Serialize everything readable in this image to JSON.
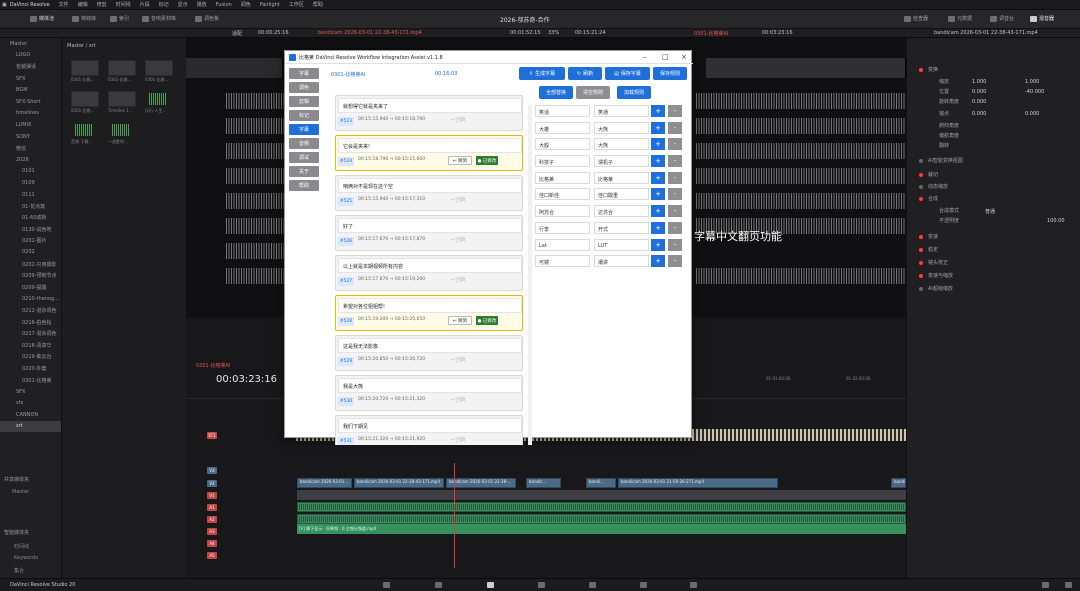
{
  "app": {
    "name": "DaVinci Resolve",
    "menus": [
      "文件",
      "编辑",
      "修剪",
      "时间线",
      "片段",
      "标记",
      "显示",
      "播放",
      "Fusion",
      "调色",
      "Fairlight",
      "工作区",
      "帮助"
    ]
  },
  "toolbar": {
    "items": [
      "媒体池",
      "特效库",
      "索引",
      "音响素材库",
      "调色板"
    ],
    "right_items": [
      "检查器",
      "元数据",
      "调音台",
      "混音器"
    ],
    "project_title": "2026-邬苏奇-合作"
  },
  "timebar": {
    "zoom": "适配",
    "tc1": "00:00:25:16",
    "clip_name": "bandicam 2026-03-01 22-38-43-171.mp4",
    "tc2": "00:01:52:15",
    "percent": "33%",
    "tc3": "00:15:21:24",
    "tl_name": "0301-比格莱AI",
    "tc4": "00:03:23:16",
    "insp_clip": "bandicam 2026-03-01 22-38-43-171.mp4"
  },
  "bins": [
    "Master",
    "LOGO",
    "包装弹话",
    "SFX",
    "BGM",
    "SFX-Short",
    "timelines",
    "LUMIX",
    "SONY",
    "微信",
    "2026",
    "0101",
    "0109",
    "0111",
    "01-花点篇",
    "01-60成新",
    "0130-说色地",
    "0201-图片",
    "0202",
    "0202-只用摄影",
    "0209-预制节点",
    "0209-提醒",
    "0210-thenog...",
    "0212-混杂调色",
    "0216-拍色帖",
    "0217-混杂调色",
    "0218-清高华",
    "0219-紫云台",
    "0220-外套",
    "0301-比格莱",
    "SFX",
    "sfx",
    "CANNON",
    "srt"
  ],
  "bins_bottom": {
    "shared": "共享媒体夹",
    "master": "Master",
    "smart": "智能媒体夹",
    "items": [
      "时间线",
      "Keywords",
      "集合"
    ]
  },
  "media": {
    "header": "Master / srt",
    "thumbs": [
      "0301-比格...",
      "0301-比格...",
      "0301-比格...",
      "0301-比格...",
      "Timeline 1...",
      "乐行-人生..",
      "音频-下载...",
      "一战胜利..."
    ]
  },
  "inspector": {
    "rows": [
      "变换",
      "缩放",
      "位置",
      "旋转角度",
      "锚点",
      "俯仰角度",
      "偏航角度",
      "翻转",
      "AI智能变换抠图",
      "裁切",
      "动态缩放",
      "合成",
      "合成模式",
      "不透明度",
      "变速",
      "稳定",
      "镜头校正",
      "变速与缩放",
      "AI超级缩放"
    ],
    "values": {
      "zoom_x": "1.000",
      "zoom_y": "1.000",
      "pos_x": "0.000",
      "pos_y": "-40.000",
      "rot": "0.000",
      "anchor_x": "0.000",
      "anchor_y": "0.000",
      "comp_mode": "普通",
      "opacity": "100.00"
    }
  },
  "timeline": {
    "tc": "00:03:23:16",
    "tab": "0301-比格莱AI",
    "tracks": [
      "ST1",
      "V3",
      "V2",
      "V1",
      "A1",
      "A2",
      "A3",
      "A4",
      "A5"
    ],
    "video_clips": [
      "bandicam 2026-03-01...",
      "bandicam 2026-03-01 22-38-43-171.mp4",
      "bandicam 2026-03-01 22-38-...",
      "bandic...",
      "bandi...",
      "bandicam 2026-03-01 21-50-26-271.mp4",
      "bandi...",
      "bandicam 2026-03-01 21-50-26-271.mp4"
    ],
    "sub_clip": "[V] 脚下显示 - 风筝频 : 0.主频分频道.mp4",
    "ruler": [
      "01:01:00:00",
      "01:02:00:00",
      "01:03:00:00",
      "01:04:00:00",
      "01:05:00:00"
    ]
  },
  "bottombar": {
    "product": "DaVinci Resolve Studio 20"
  },
  "modal": {
    "title": "比格莱 DaVinci Resolve Workflow Integration Assist v1.1.8",
    "side": [
      "字幕",
      "调色",
      "剪辑",
      "标记",
      "字幕",
      "音频",
      "调试",
      "关于",
      "帮助"
    ],
    "head_left": "0301-比格莱AI",
    "head_right": "00:16:03",
    "btns": {
      "gen": "生成字幕",
      "refresh": "刷新",
      "save": "保存字幕",
      "save_rules": "保存规则",
      "replace_all": "全部替换",
      "clear": "清空规则",
      "load": "加载规则"
    },
    "subs": [
      {
        "text": "就想得它就是夹来了",
        "idx": "#523",
        "tc": "00:15:15,940 → 00:15:18,790",
        "ph": "↩ 回跳"
      },
      {
        "text": "它会是夹来!",
        "idx": "#524",
        "tc": "00:15:18,790 → 00:15:15,600",
        "jump": "↩ 跳到",
        "done": "● 已修改"
      },
      {
        "text": "咱俩对不是现在这个空",
        "idx": "#525",
        "tc": "00:15:15,940 → 00:15:17,310",
        "ph": "↩ 回跳"
      },
      {
        "text": "好了",
        "idx": "#526",
        "tc": "00:15:17,670 → 00:15:17,870",
        "ph": "↩ 回跳"
      },
      {
        "text": "以上就是本期视频所有内容",
        "idx": "#527",
        "tc": "00:15:17,870 → 00:15:19,200",
        "ph": "↩ 回跳"
      },
      {
        "text": "希望对各位姐姐帮!",
        "idx": "#528",
        "tc": "00:15:19,200 → 00:15:20,650",
        "jump": "↩ 跳到",
        "done": "● 已修改"
      },
      {
        "text": "这是我无法影像",
        "idx": "#529",
        "tc": "00:15:20,850 → 00:15:20,720",
        "ph": "↩ 回跳"
      },
      {
        "text": "我是大熊",
        "idx": "#530",
        "tc": "00:15:20,720 → 00:15:21,320",
        "ph": "↩ 回跳"
      },
      {
        "text": "我们下期见",
        "idx": "#531",
        "tc": "00:15:21,320 → 00:15:21,920",
        "ph": "↩ 回跳"
      }
    ],
    "rules": [
      [
        "笑话",
        "笑通"
      ],
      [
        "大雄",
        "大熊"
      ],
      [
        "大殴",
        "大熊"
      ],
      [
        "科技子",
        "谓机子"
      ],
      [
        "比格莱",
        "比格莱"
      ],
      [
        "佳口新佳",
        "佳口酸重"
      ],
      [
        "阿苏合",
        "达苏合"
      ],
      [
        "行李",
        "开式"
      ],
      [
        "Lat",
        "LUT"
      ],
      [
        "可镜",
        "潮讲"
      ]
    ],
    "overlay_text": "字幕中文翻页功能"
  }
}
